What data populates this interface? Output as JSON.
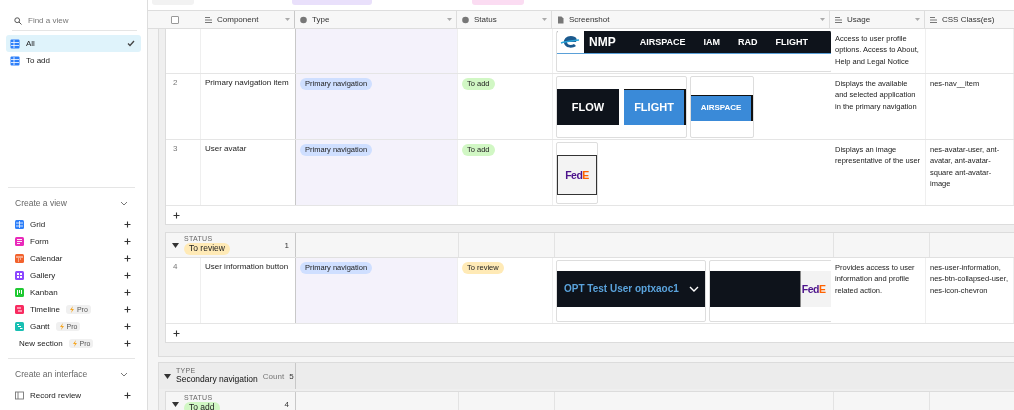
{
  "sidebar": {
    "search": {
      "placeholder": "Find a view"
    },
    "views": [
      {
        "label": "All",
        "selected": true
      },
      {
        "label": "To add",
        "selected": false
      }
    ],
    "create_view": {
      "title": "Create a view",
      "items": [
        {
          "kind": "grid",
          "label": "Grid",
          "color": "#2d7ff9"
        },
        {
          "kind": "form",
          "label": "Form",
          "color": "#e929ba"
        },
        {
          "kind": "calendar",
          "label": "Calendar",
          "color": "#f2622d"
        },
        {
          "kind": "gallery",
          "label": "Gallery",
          "color": "#8b46ff"
        },
        {
          "kind": "kanban",
          "label": "Kanban",
          "color": "#20c933"
        },
        {
          "kind": "timeline",
          "label": "Timeline",
          "color": "#f82b60",
          "badge": "Pro"
        },
        {
          "kind": "gantt",
          "label": "Gantt",
          "color": "#18bfb2",
          "badge": "Pro"
        },
        {
          "kind": "section",
          "label": "New section",
          "badge": "Pro"
        }
      ]
    },
    "create_interface": {
      "title": "Create an interface",
      "items": [
        {
          "kind": "record",
          "label": "Record review"
        }
      ]
    }
  },
  "select_all": {
    "checked": false
  },
  "columns": [
    {
      "kind": "text",
      "label": "Component"
    },
    {
      "kind": "select",
      "label": "Type"
    },
    {
      "kind": "select",
      "label": "Status"
    },
    {
      "kind": "attachment",
      "label": "Screenshot"
    },
    {
      "kind": "text",
      "label": "Usage"
    },
    {
      "kind": "text",
      "label": "CSS Class(es)"
    }
  ],
  "groups": [
    {
      "subgroups": [
        {
          "rows": [
            {
              "screenshots": [
                {
                  "kind": "navbar",
                  "brand": "NMP",
                  "items": [
                    "AIRSPACE",
                    "IAM",
                    "RAD",
                    "FLIGHT"
                  ]
                }
              ],
              "usage": "Access to user profile options. Access to About, Help and Legal Notice"
            },
            {
              "number": "2",
              "component": "Primary navigation item",
              "type": {
                "label": "Primary navigation",
                "color": "#cfdfff"
              },
              "status": {
                "label": "To add",
                "color": "#d1f7c4"
              },
              "screenshots": [
                {
                  "kind": "tabs",
                  "items": [
                    {
                      "label": "FLOW",
                      "selected": false
                    },
                    {
                      "label": "FLIGHT",
                      "selected": true
                    }
                  ]
                },
                {
                  "kind": "tabs",
                  "items": [
                    {
                      "label": "AIRSPACE",
                      "selected": true
                    }
                  ]
                }
              ],
              "usage": "Displays the available and selected application in the primary navigation",
              "css": "nes-nav__item"
            },
            {
              "number": "3",
              "component": "User avatar",
              "type": {
                "label": "Primary navigation",
                "color": "#cfdfff"
              },
              "status": {
                "label": "To add",
                "color": "#d1f7c4"
              },
              "screenshots": [
                {
                  "kind": "avatar",
                  "label": "Fed",
                  "accent": "E"
                }
              ],
              "usage": "Displays an image representative of the user",
              "css": "nes-avatar-user, ant-avatar, ant-avatar-square ant-avatar-image"
            }
          ]
        },
        {
          "field": "STATUS",
          "value": "To review",
          "color": "#ffeab6",
          "count": "1",
          "rows": [
            {
              "number": "4",
              "component": "User information button",
              "type": {
                "label": "Primary navigation",
                "color": "#cfdfff"
              },
              "status": {
                "label": "To review",
                "color": "#ffeab6"
              },
              "screenshots": [
                {
                  "kind": "user",
                  "label": "OPT Test User optxaoc1"
                },
                {
                  "kind": "avatar-dark",
                  "label": "Fed",
                  "accent": "E"
                }
              ],
              "usage": "Provides access to user information and profile related action.",
              "css": "nes-user-information, nes-btn-collapsed-user, nes-icon-chevron"
            }
          ]
        }
      ]
    },
    {
      "field": "TYPE",
      "value": "Secondary navigation",
      "count_label": "Count",
      "count": "5",
      "subgroups": [
        {
          "field": "STATUS",
          "value": "To add",
          "color": "#d1f7c4",
          "count": "4"
        }
      ]
    }
  ]
}
